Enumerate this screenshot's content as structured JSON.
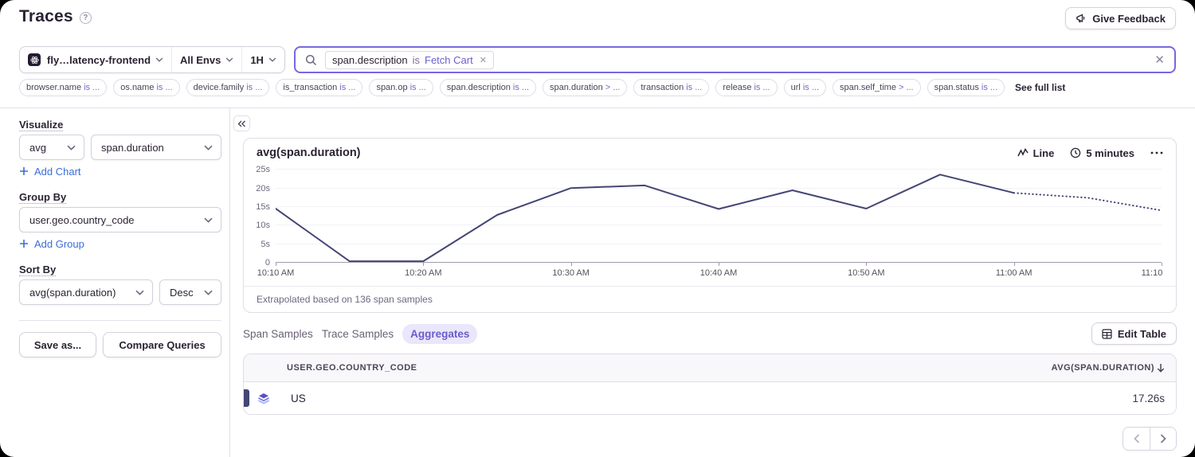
{
  "header": {
    "title": "Traces",
    "help_icon": "help-circle",
    "feedback_button": {
      "label": "Give Feedback",
      "icon": "megaphone"
    }
  },
  "filters": {
    "project": {
      "label": "fly…latency-frontend",
      "icon": "react-project-logo"
    },
    "environment": {
      "label": "All Envs"
    },
    "time_range": {
      "label": "1H"
    },
    "search": {
      "icon": "search",
      "token": {
        "key": "span.description",
        "operator": "is",
        "value": "Fetch Cart",
        "remove_icon": "×"
      },
      "clear_icon": "×"
    }
  },
  "filter_chips": {
    "items": [
      {
        "key": "browser.name",
        "op": "is ..."
      },
      {
        "key": "os.name",
        "op": "is ..."
      },
      {
        "key": "device.family",
        "op": "is ..."
      },
      {
        "key": "is_transaction",
        "op": "is ..."
      },
      {
        "key": "span.op",
        "op": "is ..."
      },
      {
        "key": "span.description",
        "op": "is ..."
      },
      {
        "key": "span.duration",
        "op": "> ..."
      },
      {
        "key": "transaction",
        "op": "is ..."
      },
      {
        "key": "release",
        "op": "is ..."
      },
      {
        "key": "url",
        "op": "is ..."
      },
      {
        "key": "span.self_time",
        "op": "> ..."
      },
      {
        "key": "span.status",
        "op": "is ..."
      }
    ],
    "more_label": "See full list"
  },
  "sidebar": {
    "visualize_label": "Visualize",
    "aggregate_select": "avg",
    "field_select": "span.duration",
    "add_chart_label": "Add Chart",
    "group_by_label": "Group By",
    "group_by_select": "user.geo.country_code",
    "add_group_label": "Add Group",
    "sort_by_label": "Sort By",
    "sort_field_select": "avg(span.duration)",
    "sort_dir_select": "Desc",
    "save_as_label": "Save as...",
    "compare_label": "Compare Queries"
  },
  "chart_data": {
    "type": "line",
    "title": "avg(span.duration)",
    "chart_type_label": "Line",
    "interval_label": "5 minutes",
    "footer": "Extrapolated based on 136 span samples",
    "unit": "seconds",
    "x": [
      "10:10",
      "10:15",
      "10:20",
      "10:25",
      "10:30",
      "10:35",
      "10:40",
      "10:45",
      "10:50",
      "10:55",
      "11:00",
      "11:05",
      "11:10"
    ],
    "values": [
      14.3,
      0.2,
      0.2,
      12.6,
      19.8,
      20.5,
      14.2,
      19.2,
      14.3,
      23.4,
      18.5,
      17.2,
      13.8
    ],
    "dotted_from_index": 10,
    "x_tick_labels": [
      "10:10 AM",
      "10:20 AM",
      "10:30 AM",
      "10:40 AM",
      "10:50 AM",
      "11:00 AM",
      "11:10"
    ],
    "y_ticks": [
      {
        "label": "0",
        "value": 0
      },
      {
        "label": "5s",
        "value": 5
      },
      {
        "label": "10s",
        "value": 10
      },
      {
        "label": "15s",
        "value": 15
      },
      {
        "label": "20s",
        "value": 20
      },
      {
        "label": "25s",
        "value": 25
      }
    ],
    "ylim": [
      0,
      27.1
    ],
    "series_color": "#444674",
    "grid": "horizontal",
    "legend_position": "none"
  },
  "tabs": {
    "items": [
      {
        "label": "Span Samples",
        "active": false
      },
      {
        "label": "Trace Samples",
        "active": false
      },
      {
        "label": "Aggregates",
        "active": true
      }
    ]
  },
  "edit_table_button": {
    "label": "Edit Table",
    "icon": "table-grid"
  },
  "table": {
    "columns": [
      {
        "label": "USER.GEO.COUNTRY_CODE",
        "align": "left"
      },
      {
        "label": "AVG(SPAN.DURATION)",
        "align": "right",
        "sort_icon": "arrow-down"
      }
    ],
    "rows": [
      {
        "swatch_color": "#444674",
        "icon": "layers",
        "country_code": "US",
        "value": "17.26s"
      }
    ]
  },
  "pagination": {
    "prev_icon": "chevron-left",
    "next_icon": "chevron-right"
  }
}
